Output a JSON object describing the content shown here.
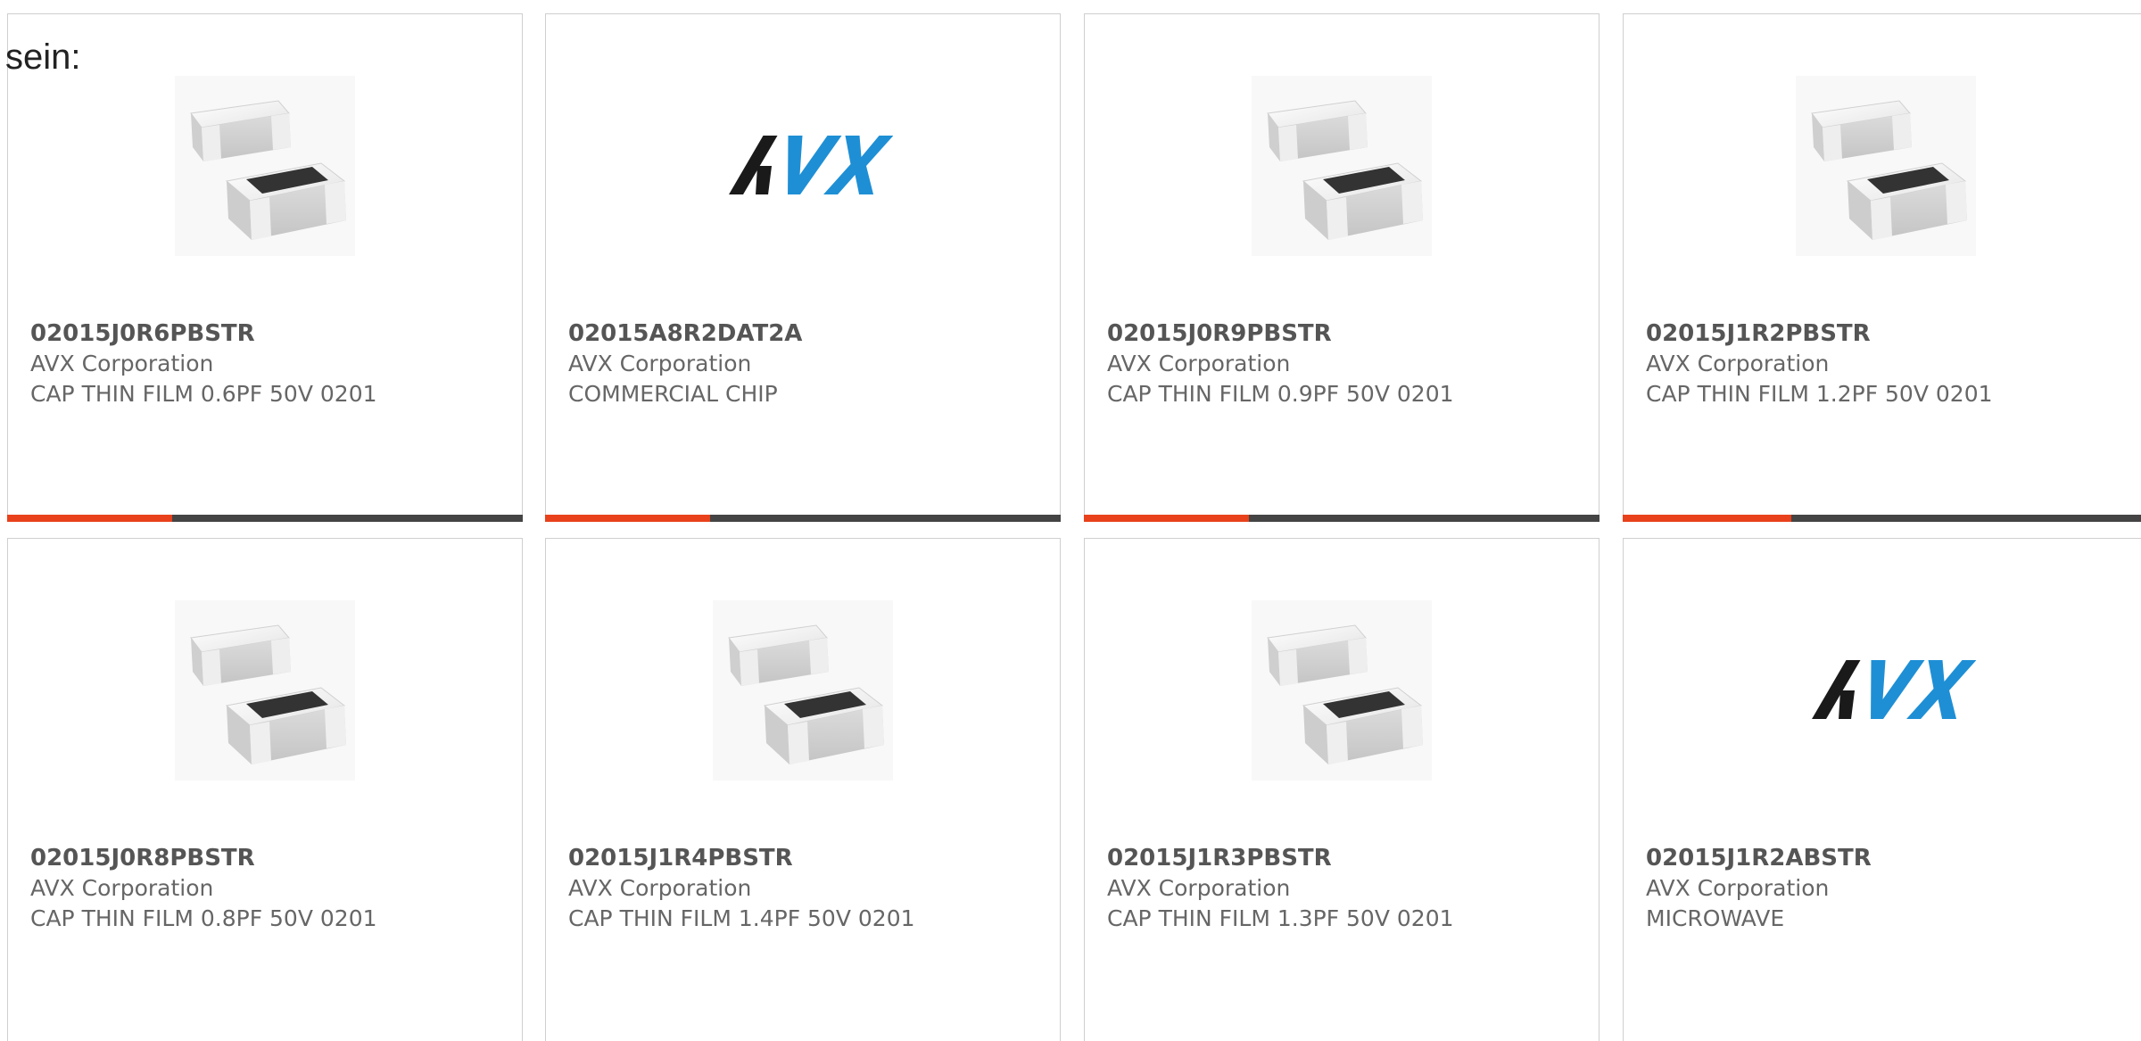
{
  "intro_text": "sein:",
  "colors": {
    "accent": "#e8411b",
    "bar_track": "#444444",
    "avx_dark": "#1a1a1a",
    "avx_blue": "#1e8fd5"
  },
  "cards": [
    {
      "part_number": "02015J0R6PBSTR",
      "manufacturer": "AVX Corporation",
      "description": "CAP THIN FILM 0.6PF 50V 0201",
      "image": "chip-capacitor-image",
      "progress": 0.32
    },
    {
      "part_number": "02015A8R2DAT2A",
      "manufacturer": "AVX Corporation",
      "description": "COMMERCIAL CHIP",
      "image": "avx-logo",
      "progress": 0.32
    },
    {
      "part_number": "02015J0R9PBSTR",
      "manufacturer": "AVX Corporation",
      "description": "CAP THIN FILM 0.9PF 50V 0201",
      "image": "chip-capacitor-image",
      "progress": 0.32
    },
    {
      "part_number": "02015J1R2PBSTR",
      "manufacturer": "AVX Corporation",
      "description": "CAP THIN FILM 1.2PF 50V 0201",
      "image": "chip-capacitor-image",
      "progress": 0.32
    },
    {
      "part_number": "02015J0R8PBSTR",
      "manufacturer": "AVX Corporation",
      "description": "CAP THIN FILM 0.8PF 50V 0201",
      "image": "chip-capacitor-image"
    },
    {
      "part_number": "02015J1R4PBSTR",
      "manufacturer": "AVX Corporation",
      "description": "CAP THIN FILM 1.4PF 50V 0201",
      "image": "chip-capacitor-image"
    },
    {
      "part_number": "02015J1R3PBSTR",
      "manufacturer": "AVX Corporation",
      "description": "CAP THIN FILM 1.3PF 50V 0201",
      "image": "chip-capacitor-image"
    },
    {
      "part_number": "02015J1R2ABSTR",
      "manufacturer": "AVX Corporation",
      "description": "MICROWAVE",
      "image": "avx-logo"
    }
  ]
}
